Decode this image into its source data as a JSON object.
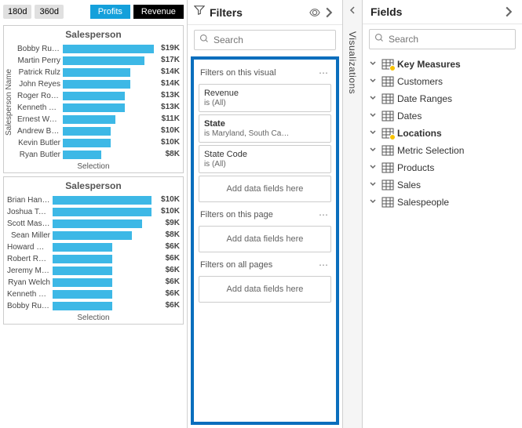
{
  "time_buttons": [
    "180d",
    "360d"
  ],
  "tabs": {
    "profits": "Profits",
    "revenue": "Revenue"
  },
  "chart_data": [
    {
      "type": "bar",
      "title": "Salesperson",
      "ylabel": "Salesperson Name",
      "xlabel": "Selection",
      "max": 19,
      "series": [
        {
          "name": "Bobby Rus…",
          "value": 19,
          "label": "$19K"
        },
        {
          "name": "Martin Perry",
          "value": 17,
          "label": "$17K"
        },
        {
          "name": "Patrick Rulz",
          "value": 14,
          "label": "$14K"
        },
        {
          "name": "John Reyes",
          "value": 14,
          "label": "$14K"
        },
        {
          "name": "Roger Rob…",
          "value": 13,
          "label": "$13K"
        },
        {
          "name": "Kenneth Fi…",
          "value": 13,
          "label": "$13K"
        },
        {
          "name": "Ernest Wag…",
          "value": 11,
          "label": "$11K"
        },
        {
          "name": "Andrew Bo…",
          "value": 10,
          "label": "$10K"
        },
        {
          "name": "Kevin Butler",
          "value": 10,
          "label": "$10K"
        },
        {
          "name": "Ryan Butler",
          "value": 8,
          "label": "$8K"
        }
      ]
    },
    {
      "type": "bar",
      "title": "Salesperson",
      "ylabel": "",
      "xlabel": "Selection",
      "max": 10,
      "series": [
        {
          "name": "Brian Hansen",
          "value": 10,
          "label": "$10K"
        },
        {
          "name": "Joshua Tayl…",
          "value": 10,
          "label": "$10K"
        },
        {
          "name": "Scott Mason",
          "value": 9,
          "label": "$9K"
        },
        {
          "name": "Sean Miller",
          "value": 8,
          "label": "$8K"
        },
        {
          "name": "Howard Ga…",
          "value": 6,
          "label": "$6K"
        },
        {
          "name": "Robert Reed",
          "value": 6,
          "label": "$6K"
        },
        {
          "name": "Jeremy Ma…",
          "value": 6,
          "label": "$6K"
        },
        {
          "name": "Ryan Welch",
          "value": 6,
          "label": "$6K"
        },
        {
          "name": "Kenneth Fi…",
          "value": 6,
          "label": "$6K"
        },
        {
          "name": "Bobby Russ…",
          "value": 6,
          "label": "$6K"
        }
      ]
    }
  ],
  "filters_panel": {
    "title": "Filters",
    "search_placeholder": "Search",
    "sections": {
      "visual": {
        "title": "Filters on this visual",
        "cards": [
          {
            "title": "Revenue",
            "sub": "is (All)",
            "bold": false
          },
          {
            "title": "State",
            "sub": "is Maryland, South Ca…",
            "bold": true
          },
          {
            "title": "State Code",
            "sub": "is (All)",
            "bold": false
          }
        ],
        "add": "Add data fields here"
      },
      "page": {
        "title": "Filters on this page",
        "add": "Add data fields here"
      },
      "all": {
        "title": "Filters on all pages",
        "add": "Add data fields here"
      }
    }
  },
  "visualizations_label": "Visualizations",
  "fields_panel": {
    "title": "Fields",
    "search_placeholder": "Search",
    "tables": [
      {
        "name": "Key Measures",
        "bold": true,
        "badge": true
      },
      {
        "name": "Customers",
        "bold": false,
        "badge": false
      },
      {
        "name": "Date Ranges",
        "bold": false,
        "badge": false
      },
      {
        "name": "Dates",
        "bold": false,
        "badge": false
      },
      {
        "name": "Locations",
        "bold": true,
        "badge": true
      },
      {
        "name": "Metric Selection",
        "bold": false,
        "badge": false
      },
      {
        "name": "Products",
        "bold": false,
        "badge": false
      },
      {
        "name": "Sales",
        "bold": false,
        "badge": false
      },
      {
        "name": "Salespeople",
        "bold": false,
        "badge": false
      }
    ]
  }
}
